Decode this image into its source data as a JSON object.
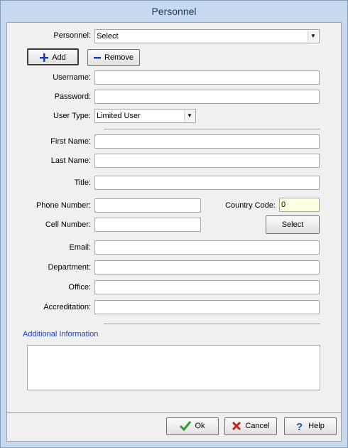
{
  "window": {
    "title": "Personnel"
  },
  "form": {
    "personnel": {
      "label": "Personnel:",
      "value": "Select"
    },
    "add_label": "Add",
    "remove_label": "Remove",
    "username": {
      "label": "Username:",
      "value": ""
    },
    "password": {
      "label": "Password:",
      "value": ""
    },
    "user_type": {
      "label": "User Type:",
      "value": "Limited User"
    },
    "first_name": {
      "label": "First Name:",
      "value": ""
    },
    "last_name": {
      "label": "Last Name:",
      "value": ""
    },
    "title": {
      "label": "Title:",
      "value": ""
    },
    "phone": {
      "label": "Phone Number:",
      "value": ""
    },
    "country_code": {
      "label": "Country Code:",
      "value": "0"
    },
    "cell": {
      "label": "Cell Number:",
      "value": ""
    },
    "select_label": "Select",
    "email": {
      "label": "Email:",
      "value": ""
    },
    "department": {
      "label": "Department:",
      "value": ""
    },
    "office": {
      "label": "Office:",
      "value": ""
    },
    "accreditation": {
      "label": "Accreditation:",
      "value": ""
    },
    "additional_info": {
      "label": "Additional Information",
      "value": ""
    }
  },
  "footer": {
    "ok_label": "Ok",
    "cancel_label": "Cancel",
    "help_label": "Help"
  },
  "colors": {
    "title_text": "#1e3a5a",
    "section_title": "#1f3fbf",
    "country_code_bg": "#ffffe1",
    "ok_icon": "#2a9d2a",
    "cancel_icon": "#c82020",
    "help_icon": "#2050c0"
  },
  "icons": {
    "add": "plus-icon",
    "remove": "minus-icon",
    "ok": "checkmark-icon",
    "cancel": "x-icon",
    "help": "question-mark-icon",
    "dropdown": "chevron-down-icon"
  }
}
